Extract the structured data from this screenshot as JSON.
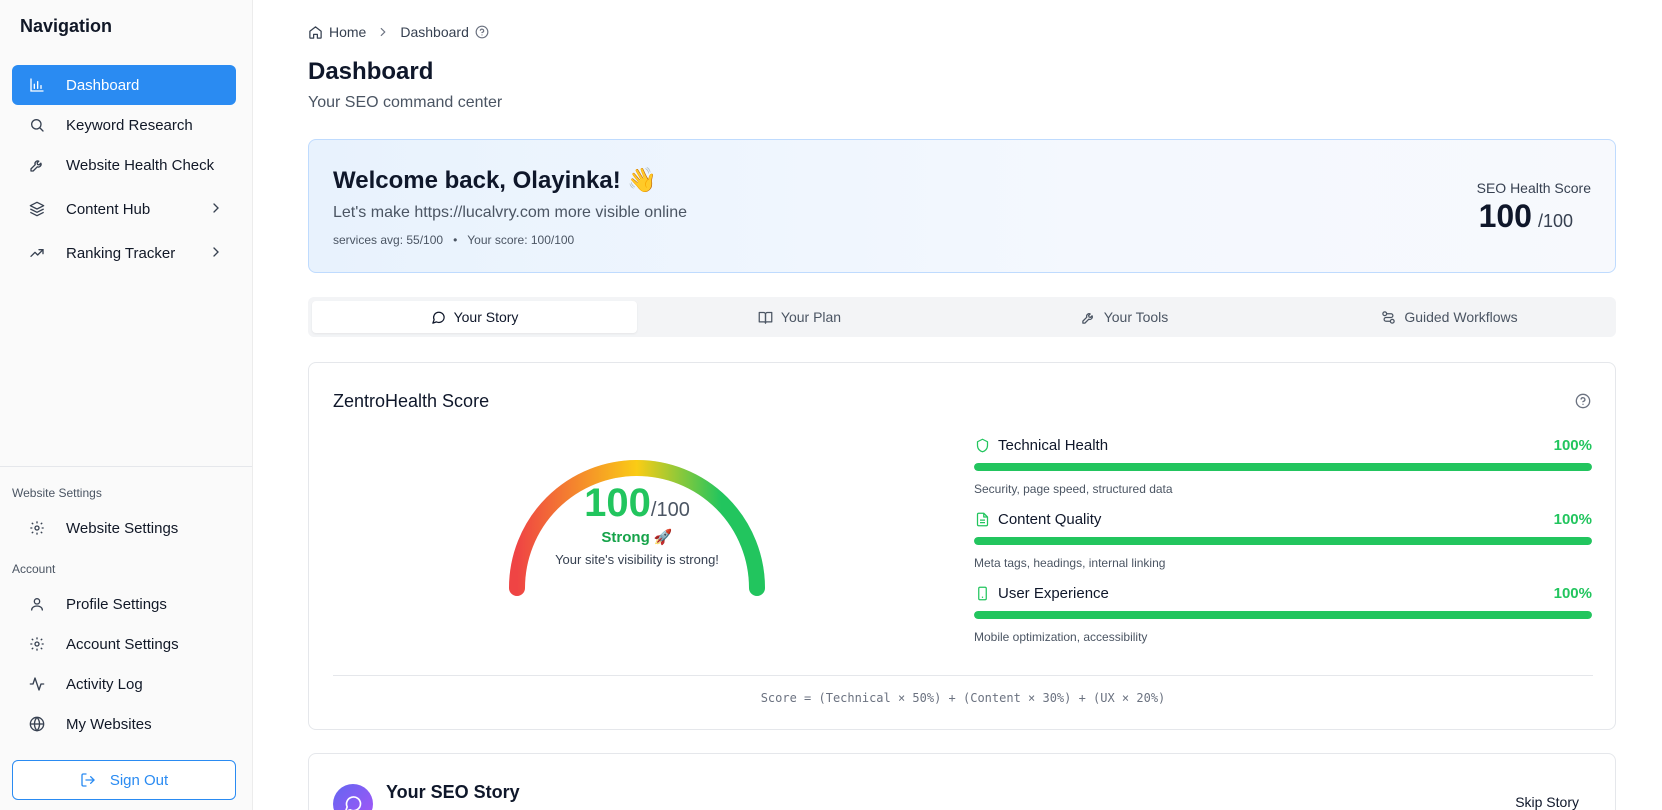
{
  "sidebar": {
    "title": "Navigation",
    "items": [
      {
        "label": "Dashboard",
        "icon": "bar-chart-icon",
        "active": true
      },
      {
        "label": "Keyword Research",
        "icon": "search-icon"
      },
      {
        "label": "Website Health Check",
        "icon": "wrench-icon"
      },
      {
        "label": "Content Hub",
        "icon": "layers-icon",
        "has_children": true
      },
      {
        "label": "Ranking Tracker",
        "icon": "trending-up-icon",
        "has_children": true
      }
    ],
    "website_settings_group": "Website Settings",
    "website_settings_items": [
      {
        "label": "Website Settings",
        "icon": "gear-icon"
      }
    ],
    "account_group": "Account",
    "account_items": [
      {
        "label": "Profile Settings",
        "icon": "user-icon"
      },
      {
        "label": "Account Settings",
        "icon": "gear-icon"
      },
      {
        "label": "Activity Log",
        "icon": "activity-icon"
      },
      {
        "label": "My Websites",
        "icon": "globe-icon"
      }
    ],
    "sign_out": "Sign Out"
  },
  "breadcrumb": {
    "home": "Home",
    "current": "Dashboard"
  },
  "page": {
    "title": "Dashboard",
    "subtitle": "Your SEO command center"
  },
  "welcome": {
    "title": "Welcome back, Olayinka! 👋",
    "subtitle": "Let's make https://lucalvry.com more visible online",
    "services_avg": "services avg: 55/100",
    "bullet": "•",
    "your_score": "Your score: 100/100",
    "score_label": "SEO Health Score",
    "score_value": "100",
    "score_denominator": "/100"
  },
  "tabs": [
    {
      "label": "Your Story",
      "icon": "message-circle-icon",
      "active": true
    },
    {
      "label": "Your Plan",
      "icon": "book-open-icon"
    },
    {
      "label": "Your Tools",
      "icon": "wrench-icon"
    },
    {
      "label": "Guided Workflows",
      "icon": "workflow-icon"
    }
  ],
  "health": {
    "title": "ZentroHealth Score",
    "gauge": {
      "value": "100",
      "denominator": "/100",
      "fraction": 1.0,
      "status": "Strong 🚀",
      "message": "Your site's visibility is strong!",
      "colors": {
        "low": "#ef4444",
        "mid": "#facc15",
        "high": "#22c55e"
      }
    },
    "metrics": [
      {
        "name": "Technical Health",
        "percent": "100%",
        "fraction": 1.0,
        "desc": "Security, page speed, structured data",
        "icon": "shield-icon"
      },
      {
        "name": "Content Quality",
        "percent": "100%",
        "fraction": 1.0,
        "desc": "Meta tags, headings, internal linking",
        "icon": "file-text-icon"
      },
      {
        "name": "User Experience",
        "percent": "100%",
        "fraction": 1.0,
        "desc": "Mobile optimization, accessibility",
        "icon": "smartphone-icon"
      }
    ],
    "formula": "Score = (Technical × 50%) + (Content × 30%) + (UX × 20%)"
  },
  "story": {
    "title": "Your SEO Story",
    "skip": "Skip Story"
  },
  "colors": {
    "accent": "#2a8bf2",
    "success": "#22c55e"
  }
}
